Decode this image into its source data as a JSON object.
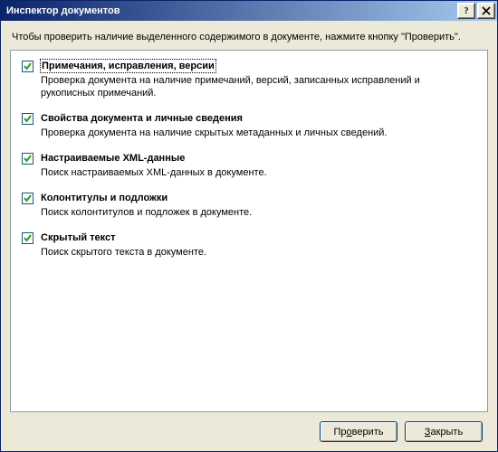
{
  "titlebar": {
    "title": "Инспектор документов"
  },
  "intro": "Чтобы проверить наличие выделенного содержимого в документе, нажмите кнопку \"Проверить\".",
  "items": [
    {
      "checked": true,
      "focused": true,
      "title": "Примечания, исправления, версии",
      "desc": "Проверка документа на наличие примечаний, версий, записанных исправлений и рукописных примечаний."
    },
    {
      "checked": true,
      "title": "Свойства документа и личные сведения",
      "desc": "Проверка документа на наличие скрытых метаданных и личных сведений."
    },
    {
      "checked": true,
      "title": "Настраиваемые XML-данные",
      "desc": "Поиск настраиваемых XML-данных в документе."
    },
    {
      "checked": true,
      "title": "Колонтитулы и подложки",
      "desc": "Поиск колонтитулов и подложек в документе."
    },
    {
      "checked": true,
      "title": "Скрытый текст",
      "desc": "Поиск скрытого текста в документе."
    }
  ],
  "buttons": {
    "inspect_pre": "Пр",
    "inspect_ul": "о",
    "inspect_post": "верить",
    "close_pre": "",
    "close_ul": "З",
    "close_post": "акрыть"
  }
}
